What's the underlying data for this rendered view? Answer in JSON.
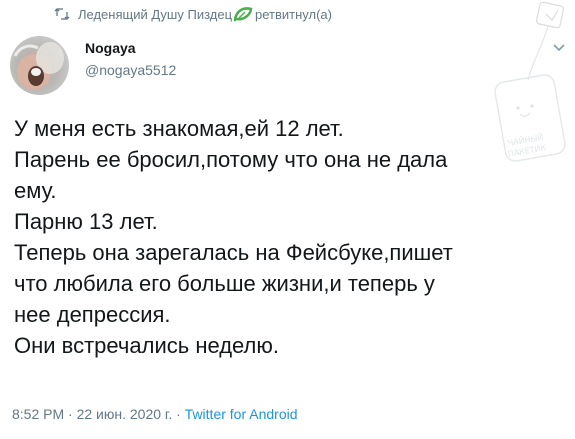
{
  "retweet": {
    "retweeter_name": "Леденящий Душу Пиздец",
    "action_text": "ретвитнул(а)"
  },
  "author": {
    "display_name": "Nogaya",
    "handle": "@nogaya5512"
  },
  "tweet": {
    "lines": [
      "У меня есть знакомая,ей 12 лет.",
      "Парень ее бросил,потому что она не дала",
      "ему.",
      "Парню 13 лет.",
      "Теперь она зарегалась на Фейсбуке,пишет",
      "что любила его больше жизни,и теперь у",
      "нее депрессия.",
      "Они встречались неделю."
    ]
  },
  "meta": {
    "time": "8:52 PM",
    "separator": "·",
    "date": "22 июн. 2020 г.",
    "source": "Twitter for Android"
  },
  "watermark": {
    "text_lines": [
      "ЧАЙНЫЙ",
      "ПАКЕТИК"
    ]
  },
  "colors": {
    "text": "#14171a",
    "secondary": "#657786",
    "link": "#1b95e0",
    "leaf_green": "#4caf50"
  },
  "icons": {
    "retweet": "retweet-icon",
    "leaf": "green-leaf-icon",
    "chevron": "chevron-down-icon",
    "watermark": "teabag-icon"
  }
}
